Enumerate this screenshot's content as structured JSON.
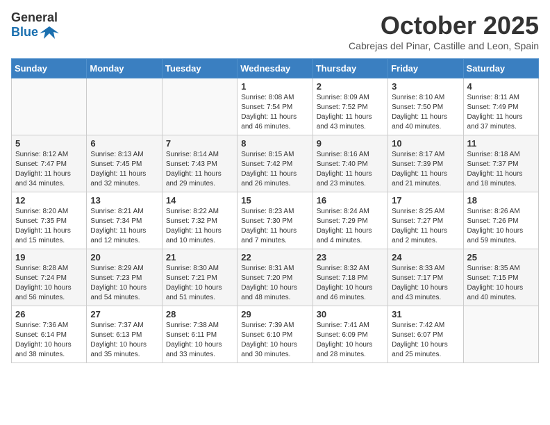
{
  "header": {
    "logo_general": "General",
    "logo_blue": "Blue",
    "month": "October 2025",
    "location": "Cabrejas del Pinar, Castille and Leon, Spain"
  },
  "weekdays": [
    "Sunday",
    "Monday",
    "Tuesday",
    "Wednesday",
    "Thursday",
    "Friday",
    "Saturday"
  ],
  "weeks": [
    [
      {
        "day": "",
        "info": ""
      },
      {
        "day": "",
        "info": ""
      },
      {
        "day": "",
        "info": ""
      },
      {
        "day": "1",
        "info": "Sunrise: 8:08 AM\nSunset: 7:54 PM\nDaylight: 11 hours and 46 minutes."
      },
      {
        "day": "2",
        "info": "Sunrise: 8:09 AM\nSunset: 7:52 PM\nDaylight: 11 hours and 43 minutes."
      },
      {
        "day": "3",
        "info": "Sunrise: 8:10 AM\nSunset: 7:50 PM\nDaylight: 11 hours and 40 minutes."
      },
      {
        "day": "4",
        "info": "Sunrise: 8:11 AM\nSunset: 7:49 PM\nDaylight: 11 hours and 37 minutes."
      }
    ],
    [
      {
        "day": "5",
        "info": "Sunrise: 8:12 AM\nSunset: 7:47 PM\nDaylight: 11 hours and 34 minutes."
      },
      {
        "day": "6",
        "info": "Sunrise: 8:13 AM\nSunset: 7:45 PM\nDaylight: 11 hours and 32 minutes."
      },
      {
        "day": "7",
        "info": "Sunrise: 8:14 AM\nSunset: 7:43 PM\nDaylight: 11 hours and 29 minutes."
      },
      {
        "day": "8",
        "info": "Sunrise: 8:15 AM\nSunset: 7:42 PM\nDaylight: 11 hours and 26 minutes."
      },
      {
        "day": "9",
        "info": "Sunrise: 8:16 AM\nSunset: 7:40 PM\nDaylight: 11 hours and 23 minutes."
      },
      {
        "day": "10",
        "info": "Sunrise: 8:17 AM\nSunset: 7:39 PM\nDaylight: 11 hours and 21 minutes."
      },
      {
        "day": "11",
        "info": "Sunrise: 8:18 AM\nSunset: 7:37 PM\nDaylight: 11 hours and 18 minutes."
      }
    ],
    [
      {
        "day": "12",
        "info": "Sunrise: 8:20 AM\nSunset: 7:35 PM\nDaylight: 11 hours and 15 minutes."
      },
      {
        "day": "13",
        "info": "Sunrise: 8:21 AM\nSunset: 7:34 PM\nDaylight: 11 hours and 12 minutes."
      },
      {
        "day": "14",
        "info": "Sunrise: 8:22 AM\nSunset: 7:32 PM\nDaylight: 11 hours and 10 minutes."
      },
      {
        "day": "15",
        "info": "Sunrise: 8:23 AM\nSunset: 7:30 PM\nDaylight: 11 hours and 7 minutes."
      },
      {
        "day": "16",
        "info": "Sunrise: 8:24 AM\nSunset: 7:29 PM\nDaylight: 11 hours and 4 minutes."
      },
      {
        "day": "17",
        "info": "Sunrise: 8:25 AM\nSunset: 7:27 PM\nDaylight: 11 hours and 2 minutes."
      },
      {
        "day": "18",
        "info": "Sunrise: 8:26 AM\nSunset: 7:26 PM\nDaylight: 10 hours and 59 minutes."
      }
    ],
    [
      {
        "day": "19",
        "info": "Sunrise: 8:28 AM\nSunset: 7:24 PM\nDaylight: 10 hours and 56 minutes."
      },
      {
        "day": "20",
        "info": "Sunrise: 8:29 AM\nSunset: 7:23 PM\nDaylight: 10 hours and 54 minutes."
      },
      {
        "day": "21",
        "info": "Sunrise: 8:30 AM\nSunset: 7:21 PM\nDaylight: 10 hours and 51 minutes."
      },
      {
        "day": "22",
        "info": "Sunrise: 8:31 AM\nSunset: 7:20 PM\nDaylight: 10 hours and 48 minutes."
      },
      {
        "day": "23",
        "info": "Sunrise: 8:32 AM\nSunset: 7:18 PM\nDaylight: 10 hours and 46 minutes."
      },
      {
        "day": "24",
        "info": "Sunrise: 8:33 AM\nSunset: 7:17 PM\nDaylight: 10 hours and 43 minutes."
      },
      {
        "day": "25",
        "info": "Sunrise: 8:35 AM\nSunset: 7:15 PM\nDaylight: 10 hours and 40 minutes."
      }
    ],
    [
      {
        "day": "26",
        "info": "Sunrise: 7:36 AM\nSunset: 6:14 PM\nDaylight: 10 hours and 38 minutes."
      },
      {
        "day": "27",
        "info": "Sunrise: 7:37 AM\nSunset: 6:13 PM\nDaylight: 10 hours and 35 minutes."
      },
      {
        "day": "28",
        "info": "Sunrise: 7:38 AM\nSunset: 6:11 PM\nDaylight: 10 hours and 33 minutes."
      },
      {
        "day": "29",
        "info": "Sunrise: 7:39 AM\nSunset: 6:10 PM\nDaylight: 10 hours and 30 minutes."
      },
      {
        "day": "30",
        "info": "Sunrise: 7:41 AM\nSunset: 6:09 PM\nDaylight: 10 hours and 28 minutes."
      },
      {
        "day": "31",
        "info": "Sunrise: 7:42 AM\nSunset: 6:07 PM\nDaylight: 10 hours and 25 minutes."
      },
      {
        "day": "",
        "info": ""
      }
    ]
  ]
}
